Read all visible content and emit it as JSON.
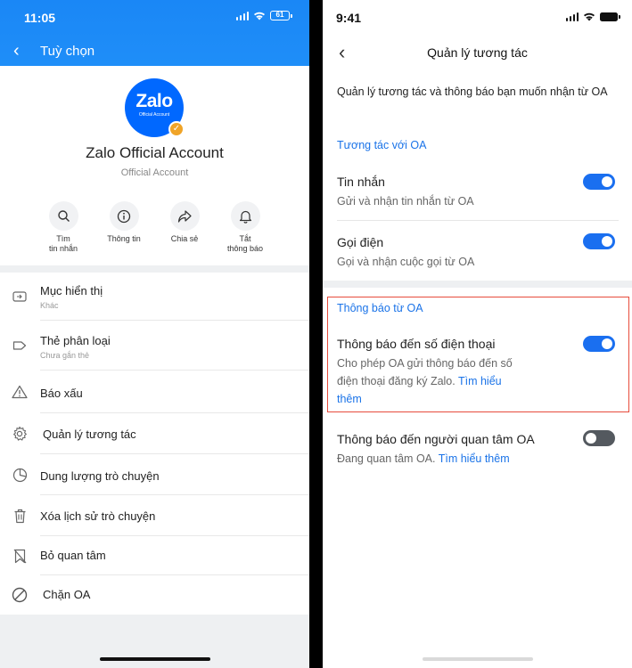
{
  "left": {
    "status_time": "11:05",
    "battery": "61",
    "header_title": "Tuỳ chọn",
    "logo_text": "Zalo",
    "logo_subtext": "Official Account",
    "account_name": "Zalo Official Account",
    "account_type": "Official Account",
    "actions": [
      {
        "label1": "Tìm",
        "label2": "tin nhắn",
        "icon": "search-icon"
      },
      {
        "label1": "Thông tin",
        "label2": "",
        "icon": "info-icon"
      },
      {
        "label1": "Chia sẻ",
        "label2": "",
        "icon": "share-icon"
      },
      {
        "label1": "Tắt",
        "label2": "thông báo",
        "icon": "bell-icon"
      }
    ],
    "menu": [
      {
        "title": "Mục hiển thị",
        "subtitle": "Khác",
        "icon": "display-icon"
      },
      {
        "title": "Thẻ phân loại",
        "subtitle": "Chưa gắn thẻ",
        "icon": "tag-icon"
      },
      {
        "title": "Báo xấu",
        "subtitle": "",
        "icon": "warning-icon"
      },
      {
        "title": "Quản lý tương tác",
        "subtitle": "",
        "icon": "gear-icon"
      },
      {
        "title": "Dung lượng trò chuyện",
        "subtitle": "",
        "icon": "pie-chart-icon"
      },
      {
        "title": "Xóa lịch sử trò chuyện",
        "subtitle": "",
        "icon": "trash-icon"
      },
      {
        "title": "Bỏ quan tâm",
        "subtitle": "",
        "icon": "unfollow-icon"
      },
      {
        "title": "Chặn OA",
        "subtitle": "",
        "icon": "block-icon"
      }
    ]
  },
  "right": {
    "status_time": "9:41",
    "header_title": "Quản lý tương tác",
    "intro": "Quản lý tương tác và thông báo bạn muốn nhận từ OA",
    "section1_title": "Tương tác với OA",
    "rows1": [
      {
        "title": "Tin nhắn",
        "desc": "Gửi và nhận tin nhắn từ OA",
        "on": true
      },
      {
        "title": "Gọi điện",
        "desc": "Gọi và nhận cuộc gọi từ OA",
        "on": true
      }
    ],
    "section2_title": "Thông báo từ OA",
    "rows2": [
      {
        "title": "Thông báo đến số điện thoại",
        "desc_line1": "Cho phép OA gửi thông báo đến số",
        "desc_line2": "điện thoại đăng ký Zalo.",
        "link_part1": "Tìm hiểu",
        "link_part2": "thêm",
        "on": true
      },
      {
        "title": "Thông báo đến người quan tâm OA",
        "desc": "Đang quan tâm OA.",
        "link": "Tìm hiểu thêm",
        "on": false
      }
    ]
  },
  "colors": {
    "brand_blue": "#1a87f6",
    "toggle_on": "#1a6ff0",
    "toggle_off": "#54595f",
    "link": "#1a73e8",
    "highlight": "#e74c3c"
  }
}
